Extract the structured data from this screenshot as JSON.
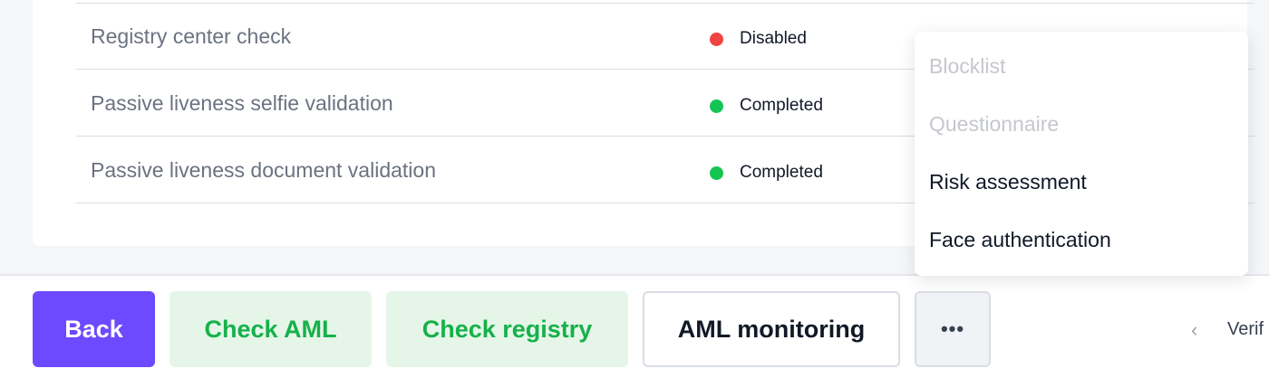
{
  "checks": {
    "rows": [
      {
        "name": "Registry center check",
        "status": "Disabled",
        "status_color": "#ef4444"
      },
      {
        "name": "Passive liveness selfie validation",
        "status": "Completed",
        "status_color": "#16c454"
      },
      {
        "name": "Passive liveness document validation",
        "status": "Completed",
        "status_color": "#16c454"
      }
    ]
  },
  "footer": {
    "back_label": "Back",
    "check_aml_label": "Check AML",
    "check_registry_label": "Check registry",
    "aml_monitoring_label": "AML monitoring",
    "more_label": "•••",
    "pager_prev": "‹",
    "pager_label": "Verif"
  },
  "menu": {
    "items": [
      {
        "label": "Blocklist",
        "disabled": true
      },
      {
        "label": "Questionnaire",
        "disabled": true
      },
      {
        "label": "Risk assessment",
        "disabled": false
      },
      {
        "label": "Face authentication",
        "disabled": false
      }
    ]
  },
  "colors": {
    "accent": "#6d4aff",
    "success": "#16c454",
    "danger": "#ef4444",
    "success_bg": "#e5f6e9",
    "success_text": "#16b14a"
  }
}
